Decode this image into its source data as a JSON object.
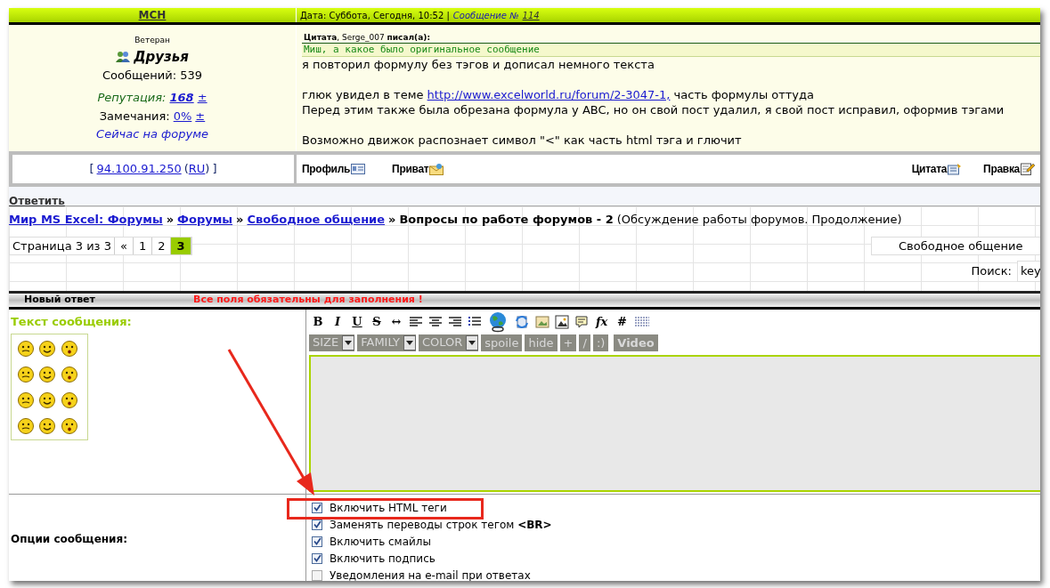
{
  "post": {
    "author": "МСН",
    "date": "Дата: Суббота, Сегодня, 10:52 |",
    "post_label": "Сообщение №",
    "post_number": "114",
    "rank": "Ветеран",
    "group": "Друзья",
    "messages": "Сообщений: 539",
    "reputation_label": "Репутация:",
    "reputation": "168",
    "reputation_pm": "±",
    "warnings_label": "Замечания:",
    "warnings": "0%",
    "warnings_pm": "±",
    "online": "Сейчас на форуме",
    "quote_header": "**Цитата**, Serge_007 **писал(а):**",
    "quote_text": "Миш, а какое было оригинальное сообщение",
    "lines": [
      {
        "kind": "text",
        "text": "я повторил формулу без тэгов и дописал немного текста"
      },
      {
        "kind": "blank"
      },
      {
        "kind": "link",
        "before": "глюк увидел в теме ",
        "link": "http://www.excelworld.ru/forum/2-3047-1,",
        "after": " часть формулы оттуда"
      },
      {
        "kind": "text",
        "text": "Перед этим также была обрезана формула у ABC, но он свой пост удалил, я свой пост исправил, оформив тэгами"
      },
      {
        "kind": "blank"
      },
      {
        "kind": "text",
        "text": "Возможно движок распознает символ \"<\" как часть html тэга и глючит"
      }
    ],
    "ip_open": "[",
    "ip": "94.100.91.250",
    "country_open": "(",
    "country": "RU",
    "country_close": ")",
    "ip_close": "]",
    "actions_left": [
      "Профиль",
      "Приват"
    ],
    "actions_right": [
      "Цитата",
      "Правка"
    ]
  },
  "reply_link": "Ответить",
  "breadcrumb": {
    "links": [
      "Мир MS Excel: Форумы",
      "Форумы",
      "Свободное общение"
    ],
    "separator": "»",
    "title": "Вопросы по работе форумов - 2",
    "description": "(Обсуждение работы форумов. Продолжение)"
  },
  "pagination": {
    "label": "Страница 3 из 3",
    "pages": [
      {
        "label": "«",
        "selected": false
      },
      {
        "label": "1",
        "selected": false
      },
      {
        "label": "2",
        "selected": false
      },
      {
        "label": "3",
        "selected": true
      }
    ]
  },
  "forum_select": "Свободное общение",
  "search": {
    "label": "Поиск:",
    "value": "key"
  },
  "reply_form": {
    "title": "Новый ответ",
    "notice": "Все поля обязательны для заполнения !",
    "message_label": "Текст сообщения:",
    "toolbar": [
      {
        "kind": "glyph",
        "label": "B"
      },
      {
        "kind": "glyph",
        "label": "I"
      },
      {
        "kind": "glyph",
        "label": "U"
      },
      {
        "kind": "glyph",
        "label": "S"
      },
      {
        "kind": "glyph",
        "label": "↔"
      },
      {
        "kind": "icon"
      },
      {
        "kind": "icon"
      },
      {
        "kind": "icon"
      },
      {
        "kind": "icon"
      },
      {
        "kind": "icon"
      },
      {
        "kind": "icon"
      },
      {
        "kind": "icon"
      },
      {
        "kind": "icon"
      },
      {
        "kind": "icon"
      },
      {
        "kind": "glyph",
        "label": "fx"
      },
      {
        "kind": "glyph",
        "label": "#"
      },
      {
        "kind": "icon"
      }
    ],
    "tag_buttons": [
      {
        "kind": "dropdown",
        "label": "SIZE"
      },
      {
        "kind": "dropdown",
        "label": "FAMILY"
      },
      {
        "kind": "dropdown",
        "label": "COLOR"
      },
      {
        "kind": "button",
        "label": "spoile"
      },
      {
        "kind": "button",
        "label": "hide"
      },
      {
        "kind": "button",
        "label": "+"
      },
      {
        "kind": "button",
        "label": "/"
      },
      {
        "kind": "button",
        "label": ":)"
      },
      {
        "kind": "button",
        "label": "Video"
      }
    ],
    "options_label": "Опции сообщения:",
    "options": [
      {
        "label": "Включить HTML теги",
        "checked": true
      },
      {
        "label": "Заменять переводы строк тегом **<BR>**",
        "checked": true
      },
      {
        "label": "Включить смайлы",
        "checked": true
      },
      {
        "label": "Включить подпись",
        "checked": true
      },
      {
        "label": "Уведомления на e-mail при ответах",
        "checked": false
      }
    ]
  }
}
